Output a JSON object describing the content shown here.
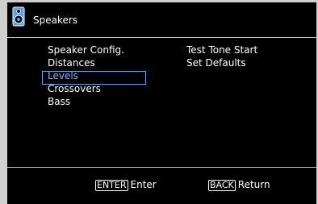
{
  "header": {
    "title": "Speakers",
    "icon": "speaker-icon"
  },
  "menu": {
    "left": [
      {
        "label": "Speaker Config."
      },
      {
        "label": "Distances"
      },
      {
        "label": "Levels",
        "selected": true
      },
      {
        "label": "Crossovers"
      },
      {
        "label": "Bass"
      }
    ],
    "right": [
      {
        "label": "Test Tone Start"
      },
      {
        "label": "Set Defaults"
      }
    ]
  },
  "footer": {
    "enter_key": "ENTER",
    "enter_label": "Enter",
    "back_key": "BACK",
    "back_label": "Return"
  },
  "colors": {
    "background": "#000000",
    "text": "#ffffff",
    "selected_text": "#7fb0ff",
    "selected_border": "#6f9fe8",
    "divider": "#bfbfbf",
    "icon": "#4fa3e8"
  }
}
